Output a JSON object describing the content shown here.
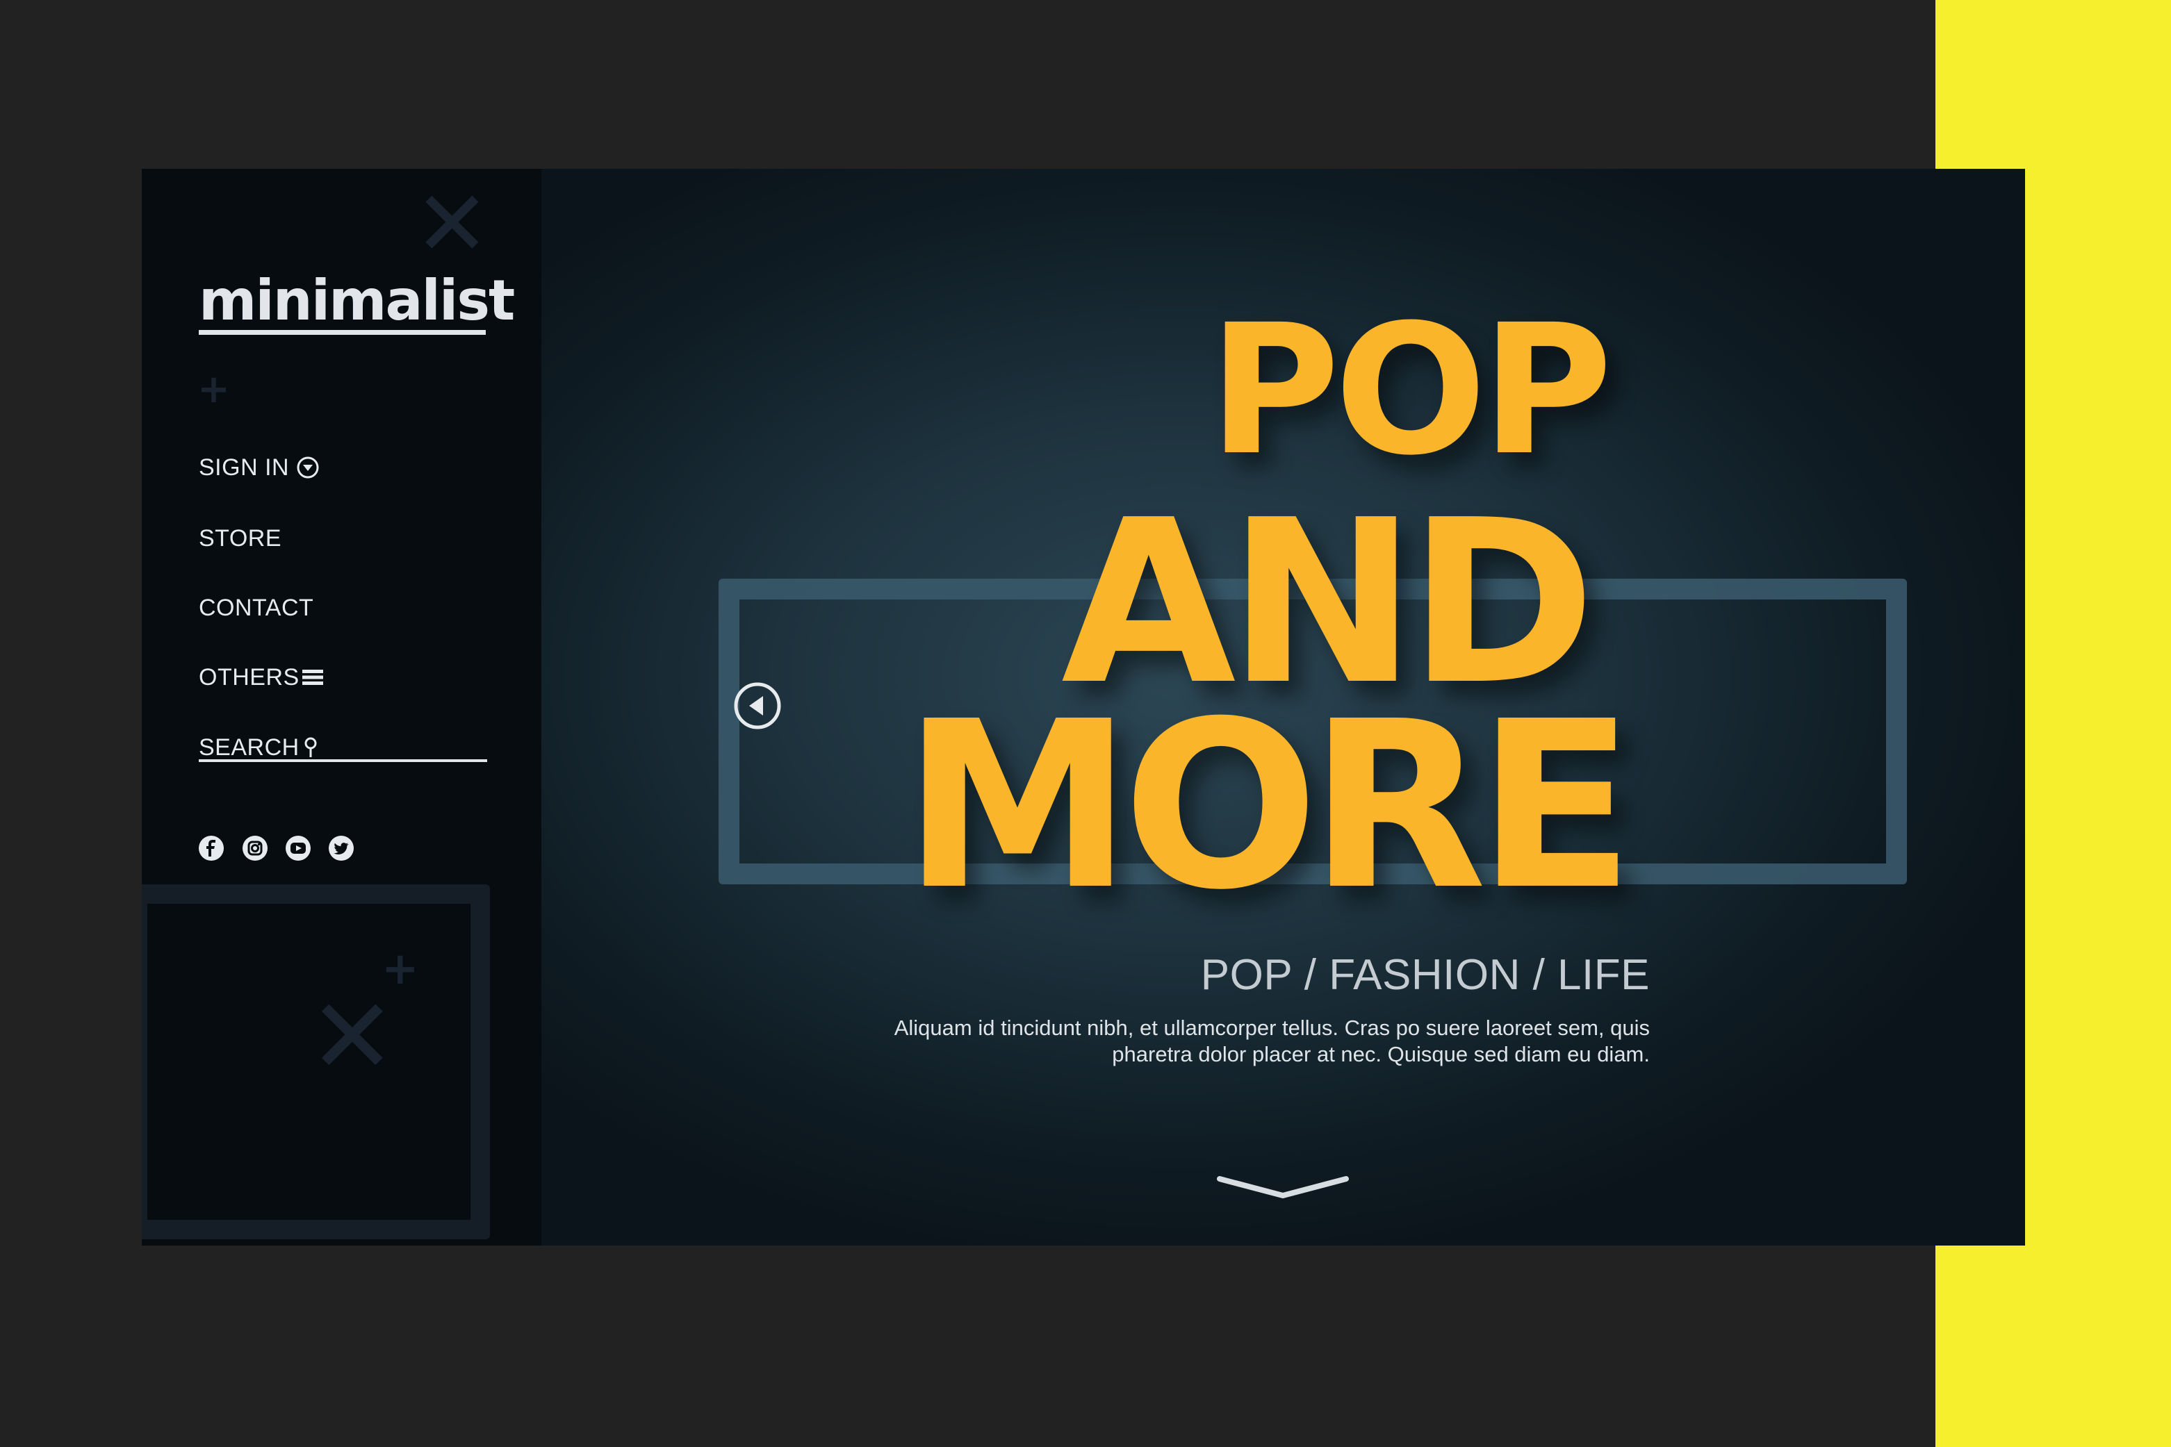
{
  "colors": {
    "outer_background": "#232223",
    "yellow_strip": "#f5ef2e",
    "sidebar_background": "#070c11",
    "hero_background": "#1d323d",
    "accent_yellow": "#fbb52a",
    "text_light": "#e8ebee"
  },
  "brand": {
    "logo_text": "minimalist"
  },
  "sidebar": {
    "nav": [
      {
        "label": "SIGN IN",
        "icon": "chevron-down-circle-icon"
      },
      {
        "label": "STORE"
      },
      {
        "label": "CONTACT"
      },
      {
        "label": "OTHERS",
        "icon": "menu-icon"
      },
      {
        "label": "SEARCH",
        "icon": "search-icon"
      }
    ],
    "social": [
      "facebook-icon",
      "instagram-icon",
      "youtube-icon",
      "twitter-icon"
    ]
  },
  "hero": {
    "title_lines": [
      "POP",
      "AND",
      "MORE"
    ],
    "tagline": "POP / FASHION / LIFE",
    "body": "Aliquam id tincidunt nibh, et ullamcorper tellus. Cras po suere laoreet sem, quis pharetra dolor placer at nec. Quisque sed diam eu diam.",
    "icons": {
      "prev": "arrow-left-circle-icon",
      "next": "arrow-right-circle-icon",
      "scroll": "chevron-down-icon"
    }
  }
}
